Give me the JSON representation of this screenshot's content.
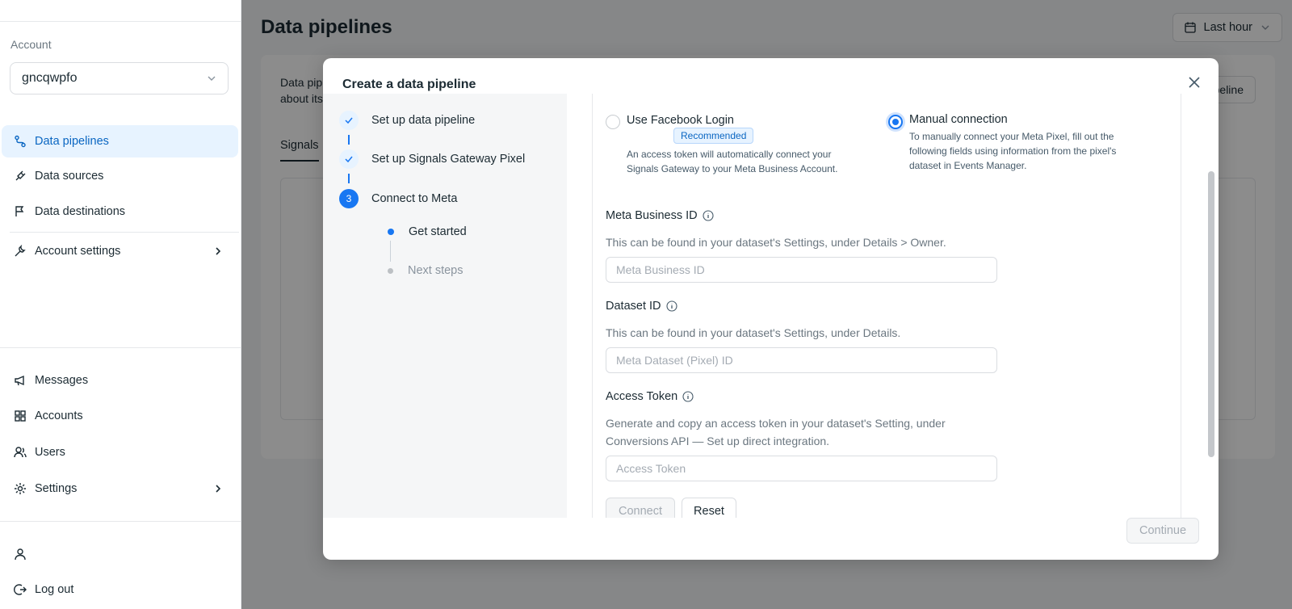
{
  "sidebar": {
    "account_label": "Account",
    "account_value": "gncqwpfo",
    "nav": [
      {
        "label": "Data pipelines"
      },
      {
        "label": "Data sources"
      },
      {
        "label": "Data destinations"
      },
      {
        "label": "Account settings"
      }
    ],
    "bottom_nav": [
      {
        "label": "Messages"
      },
      {
        "label": "Accounts"
      },
      {
        "label": "Users"
      },
      {
        "label": "Settings"
      }
    ],
    "logout_label": "Log out"
  },
  "main": {
    "title": "Data pipelines",
    "time_range": "Last hour",
    "desc_line1": "Data pip",
    "desc_line2": "about its",
    "tab": "Signals",
    "add_btn": "peline"
  },
  "modal": {
    "title": "Create a data pipeline",
    "steps": [
      {
        "label": "Set up data pipeline",
        "status": "done"
      },
      {
        "label": "Set up Signals Gateway Pixel",
        "status": "done"
      },
      {
        "label": "Connect to Meta",
        "status": "current",
        "number": "3"
      }
    ],
    "substeps": [
      {
        "label": "Get started",
        "status": "current"
      },
      {
        "label": "Next steps",
        "status": "pending"
      }
    ],
    "options": {
      "facebook": {
        "title": "Use Facebook Login",
        "badge": "Recommended",
        "desc_line1": "An access token will automatically connect your",
        "desc_line2": "Signals Gateway to your Meta Business Account."
      },
      "manual": {
        "title": "Manual connection",
        "desc_line1": "To manually connect your Meta Pixel, fill out the",
        "desc_line2": "following fields using information from the pixel's",
        "desc_line3": "dataset in Events Manager."
      }
    },
    "fields": {
      "business_id": {
        "label": "Meta Business ID",
        "help": "This can be found in your dataset's Settings, under Details > Owner.",
        "placeholder": "Meta Business ID"
      },
      "dataset_id": {
        "label": "Dataset ID",
        "help": "This can be found in your dataset's Settings, under Details.",
        "placeholder": "Meta Dataset (Pixel) ID"
      },
      "access_token": {
        "label": "Access Token",
        "help_line1": "Generate and copy an access token in your dataset's Setting, under",
        "help_line2": "Conversions API — Set up direct integration.",
        "placeholder": "Access Token"
      }
    },
    "connect_btn": "Connect",
    "reset_btn": "Reset",
    "continue_btn": "Continue"
  },
  "colors": {
    "accent": "#1877f2",
    "active_bg": "#e7f3ff",
    "overlay": "rgba(0,0,0,0.45)"
  }
}
